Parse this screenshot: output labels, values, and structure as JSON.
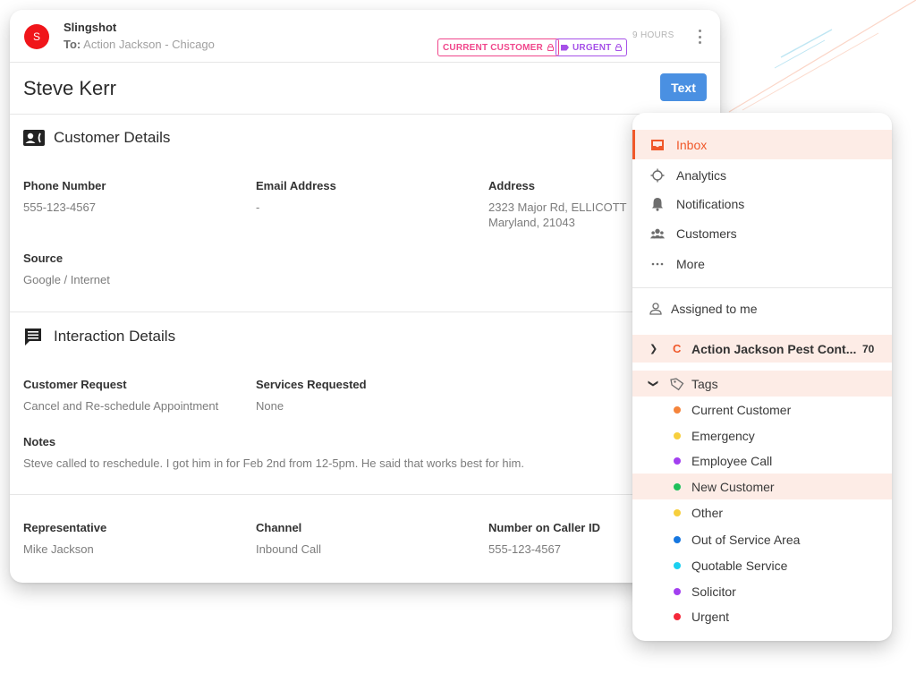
{
  "message": {
    "sender": "Slingshot",
    "avatar_letter": "S",
    "to_label": "To:",
    "to_value": "Action Jackson - Chicago",
    "badges": [
      {
        "label": "CURRENT CUSTOMER",
        "color": "#f0468b"
      },
      {
        "label": "URGENT",
        "color": "#a651e8"
      }
    ],
    "time": "9 HOURS"
  },
  "contact": {
    "name": "Steve Kerr",
    "text_button": "Text"
  },
  "customer_details": {
    "title": "Customer Details",
    "fields": [
      {
        "label": "Phone Number",
        "value": "555-123-4567"
      },
      {
        "label": "Email Address",
        "value": "-"
      },
      {
        "label": "Address",
        "value_line1": "2323 Major Rd, ELLICOTT",
        "value_line2": "Maryland, 21043"
      },
      {
        "label": "Source",
        "value": "Google / Internet"
      }
    ]
  },
  "interaction_details": {
    "title": "Interaction Details",
    "fields": [
      {
        "label": "Customer Request",
        "value": "Cancel and Re-schedule Appointment"
      },
      {
        "label": "Services Requested",
        "value": "None"
      },
      {
        "label": "Notes",
        "value": "Steve called to reschedule. I got him in for Feb 2nd from 12-5pm. He said that works best for him."
      }
    ]
  },
  "call_details": {
    "fields": [
      {
        "label": "Representative",
        "value": "Mike Jackson"
      },
      {
        "label": "Channel",
        "value": "Inbound Call"
      },
      {
        "label": "Number on Caller ID",
        "value": "555-123-4567"
      }
    ]
  },
  "nav": {
    "items": [
      {
        "label": "Inbox",
        "icon": "inbox-icon",
        "active": true
      },
      {
        "label": "Analytics",
        "icon": "crosshair-icon"
      },
      {
        "label": "Notifications",
        "icon": "bell-icon"
      },
      {
        "label": "Customers",
        "icon": "users-icon"
      },
      {
        "label": "More",
        "icon": "ellipsis-icon"
      }
    ],
    "assigned": "Assigned to me",
    "org": {
      "letter": "C",
      "name": "Action Jackson Pest Cont...",
      "count": "70"
    },
    "tags_label": "Tags",
    "tags": [
      {
        "label": "Current Customer",
        "color": "#f5843b"
      },
      {
        "label": "Emergency",
        "color": "#f7cf3d"
      },
      {
        "label": "Employee Call",
        "color": "#a23ff0"
      },
      {
        "label": "New Customer",
        "color": "#1ec05b",
        "highlighted": true
      },
      {
        "label": "Other",
        "color": "#f7cf3d"
      },
      {
        "label": "Out of Service Area",
        "color": "#1677e0"
      },
      {
        "label": "Quotable Service",
        "color": "#1bd0f0"
      },
      {
        "label": "Solicitor",
        "color": "#a23ff0"
      },
      {
        "label": "Urgent",
        "color": "#f5283a"
      }
    ]
  }
}
